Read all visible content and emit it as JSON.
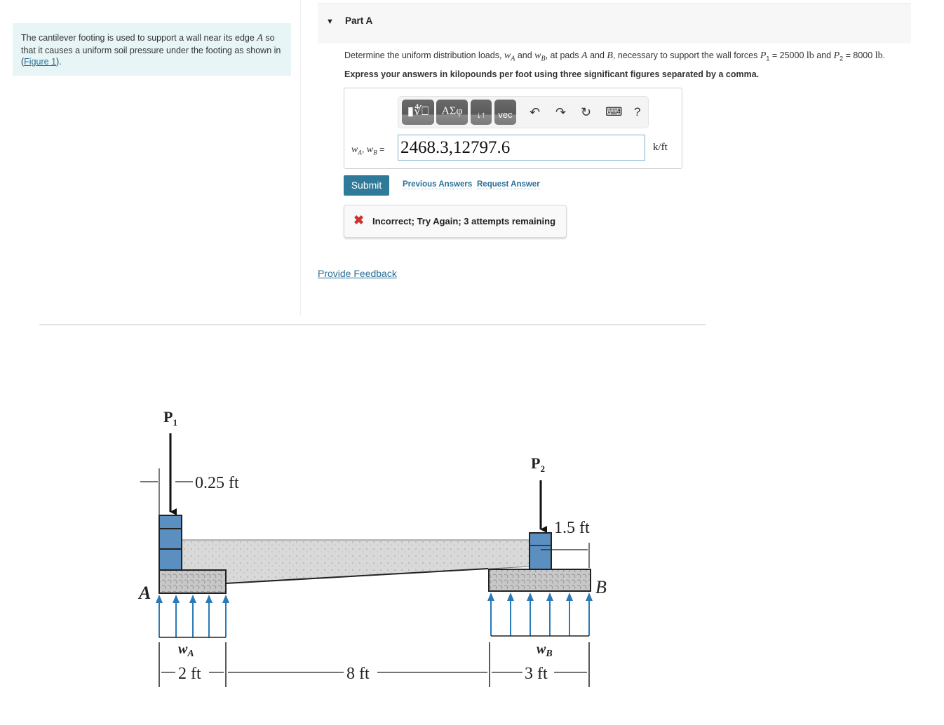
{
  "problem": {
    "text_before": "The cantilever footing is used to support a wall near its edge ",
    "edge_var": "A",
    "text_after": " so that it causes a uniform soil pressure under the footing as shown in (",
    "figure_link": "Figure 1",
    "text_end": ")."
  },
  "part": {
    "caret_icon": "▼",
    "title": "Part A",
    "question": {
      "t1": "Determine the uniform distribution loads, ",
      "wA": "w",
      "wA_sub": "A",
      "t2": " and ",
      "wB": "w",
      "wB_sub": "B",
      "t3": ", at pads ",
      "A": "A",
      "t4": " and ",
      "B": "B",
      "t5": ", necessary to support the wall forces ",
      "P1": "P",
      "P1_sub": "1",
      "t6": " = 25000 ",
      "lb1": "lb",
      "t7": " and ",
      "P2": "P",
      "P2_sub": "2",
      "t8": " = 8000 ",
      "lb2": "lb",
      "t9": "."
    },
    "instruction": "Express your answers in kilopounds per foot using three significant figures separated by a comma."
  },
  "toolbar": {
    "templates_label": "▮∜⎕",
    "greek_label": "ΑΣφ",
    "arrows_label": "↓↑",
    "vec_label": "vec",
    "undo_icon": "↶",
    "redo_icon": "↷",
    "reset_icon": "↻",
    "keyboard_icon": "⌨",
    "help_label": "?"
  },
  "answer": {
    "label_w1": "w",
    "label_s1": "A",
    "label_sep": ", ",
    "label_w2": "w",
    "label_s2": "B",
    "label_eq": " =",
    "value": "2468.3,12797.6",
    "unit": "k/ft"
  },
  "actions": {
    "submit": "Submit",
    "previous_answers": "Previous Answers",
    "request_answer": "Request Answer"
  },
  "feedback": {
    "icon": "✖",
    "message": "Incorrect; Try Again; 3 attempts remaining",
    "error_color": "#d0312d"
  },
  "provide_feedback": "Provide Feedback",
  "figure": {
    "P1": "P",
    "P1_sub": "1",
    "P2": "P",
    "P2_sub": "2",
    "dim_025": "0.25 ft",
    "dim_15": "1.5 ft",
    "label_A": "A",
    "label_B": "B",
    "wA": "w",
    "wA_sub": "A",
    "wB": "w",
    "wB_sub": "B",
    "dim_2": "2 ft",
    "dim_8": "8 ft",
    "dim_3": "3 ft",
    "colors": {
      "wall": "#5b8fc0",
      "arrow": "#2a7ab5",
      "concrete": "#d8d8d8"
    }
  }
}
